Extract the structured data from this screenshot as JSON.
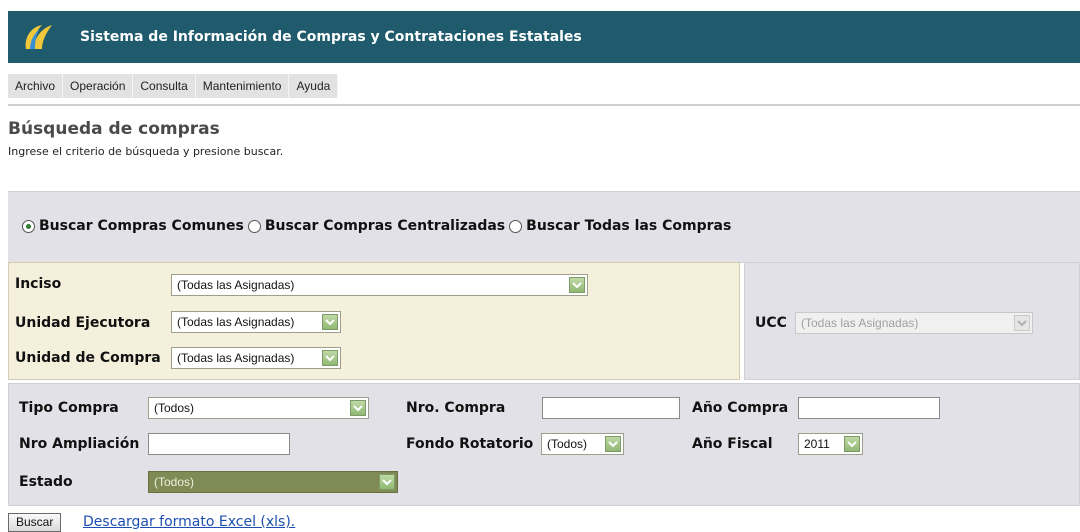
{
  "app": {
    "title": "Sistema de Información de Compras y Contrataciones Estatales"
  },
  "menu": [
    "Archivo",
    "Operación",
    "Consulta",
    "Mantenimiento",
    "Ayuda"
  ],
  "page": {
    "title": "Búsqueda de compras",
    "subtitle": "Ingrese el criterio de búsqueda y presione buscar."
  },
  "search_type": {
    "selected": "Buscar Compras Comunes",
    "options": [
      "Buscar Compras Comunes",
      "Buscar Compras Centralizadas",
      "Buscar Todas las Compras"
    ]
  },
  "org": {
    "inciso_label": "Inciso",
    "inciso_value": "(Todas las Asignadas)",
    "ue_label": "Unidad Ejecutora",
    "ue_value": "(Todas las Asignadas)",
    "uc_label": "Unidad de Compra",
    "uc_value": "(Todas las Asignadas)",
    "ucc_label": "UCC",
    "ucc_value": "(Todas las Asignadas)"
  },
  "filters": {
    "tipo_compra_label": "Tipo Compra",
    "tipo_compra_value": "(Todos)",
    "nro_compra_label": "Nro. Compra",
    "nro_compra_value": "",
    "anio_compra_label": "Año Compra",
    "anio_compra_value": "",
    "nro_ampliacion_label": "Nro Ampliación",
    "nro_ampliacion_value": "",
    "fondo_rotatorio_label": "Fondo Rotatorio",
    "fondo_rotatorio_value": "(Todos)",
    "anio_fiscal_label": "Año Fiscal",
    "anio_fiscal_value": "2011",
    "estado_label": "Estado",
    "estado_value": "(Todos)"
  },
  "actions": {
    "buscar_label": "Buscar",
    "excel_link": "Descargar formato Excel (xls)."
  },
  "colors": {
    "header": "#1f5b6c",
    "org_panel": "#f4f0dc",
    "filter_panel": "#e1e1e7",
    "link": "#1d4fb0"
  }
}
